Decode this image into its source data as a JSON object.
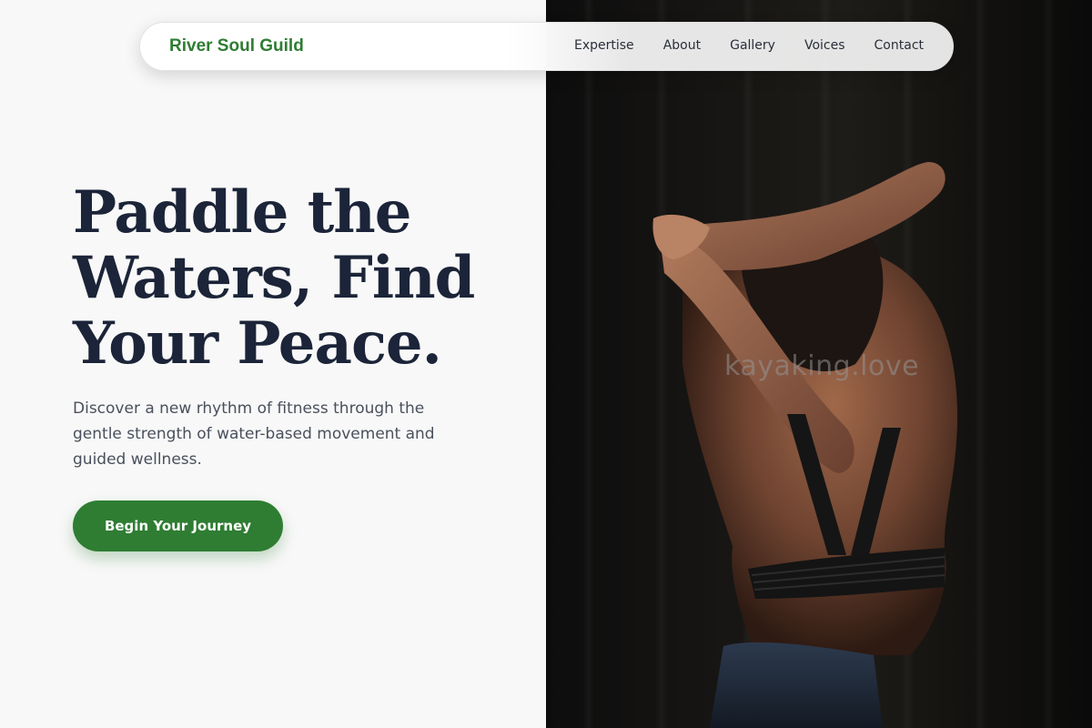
{
  "nav": {
    "brand": "River Soul Guild",
    "links": [
      "Expertise",
      "About",
      "Gallery",
      "Voices",
      "Contact"
    ]
  },
  "hero": {
    "headline_lines": [
      "Paddle the",
      "Waters, Find",
      "Your Peace."
    ],
    "subtext": "Discover a new rhythm of fitness through the gentle strength of water-based movement and guided wellness.",
    "cta_label": "Begin Your Journey"
  },
  "photo": {
    "watermark": "kayaking.love"
  },
  "colors": {
    "brand_green": "#2e7d32",
    "headline_navy": "#1b2438",
    "body_gray": "#4a505c",
    "left_background": "#f8f8f8",
    "photo_background": "#141311"
  }
}
